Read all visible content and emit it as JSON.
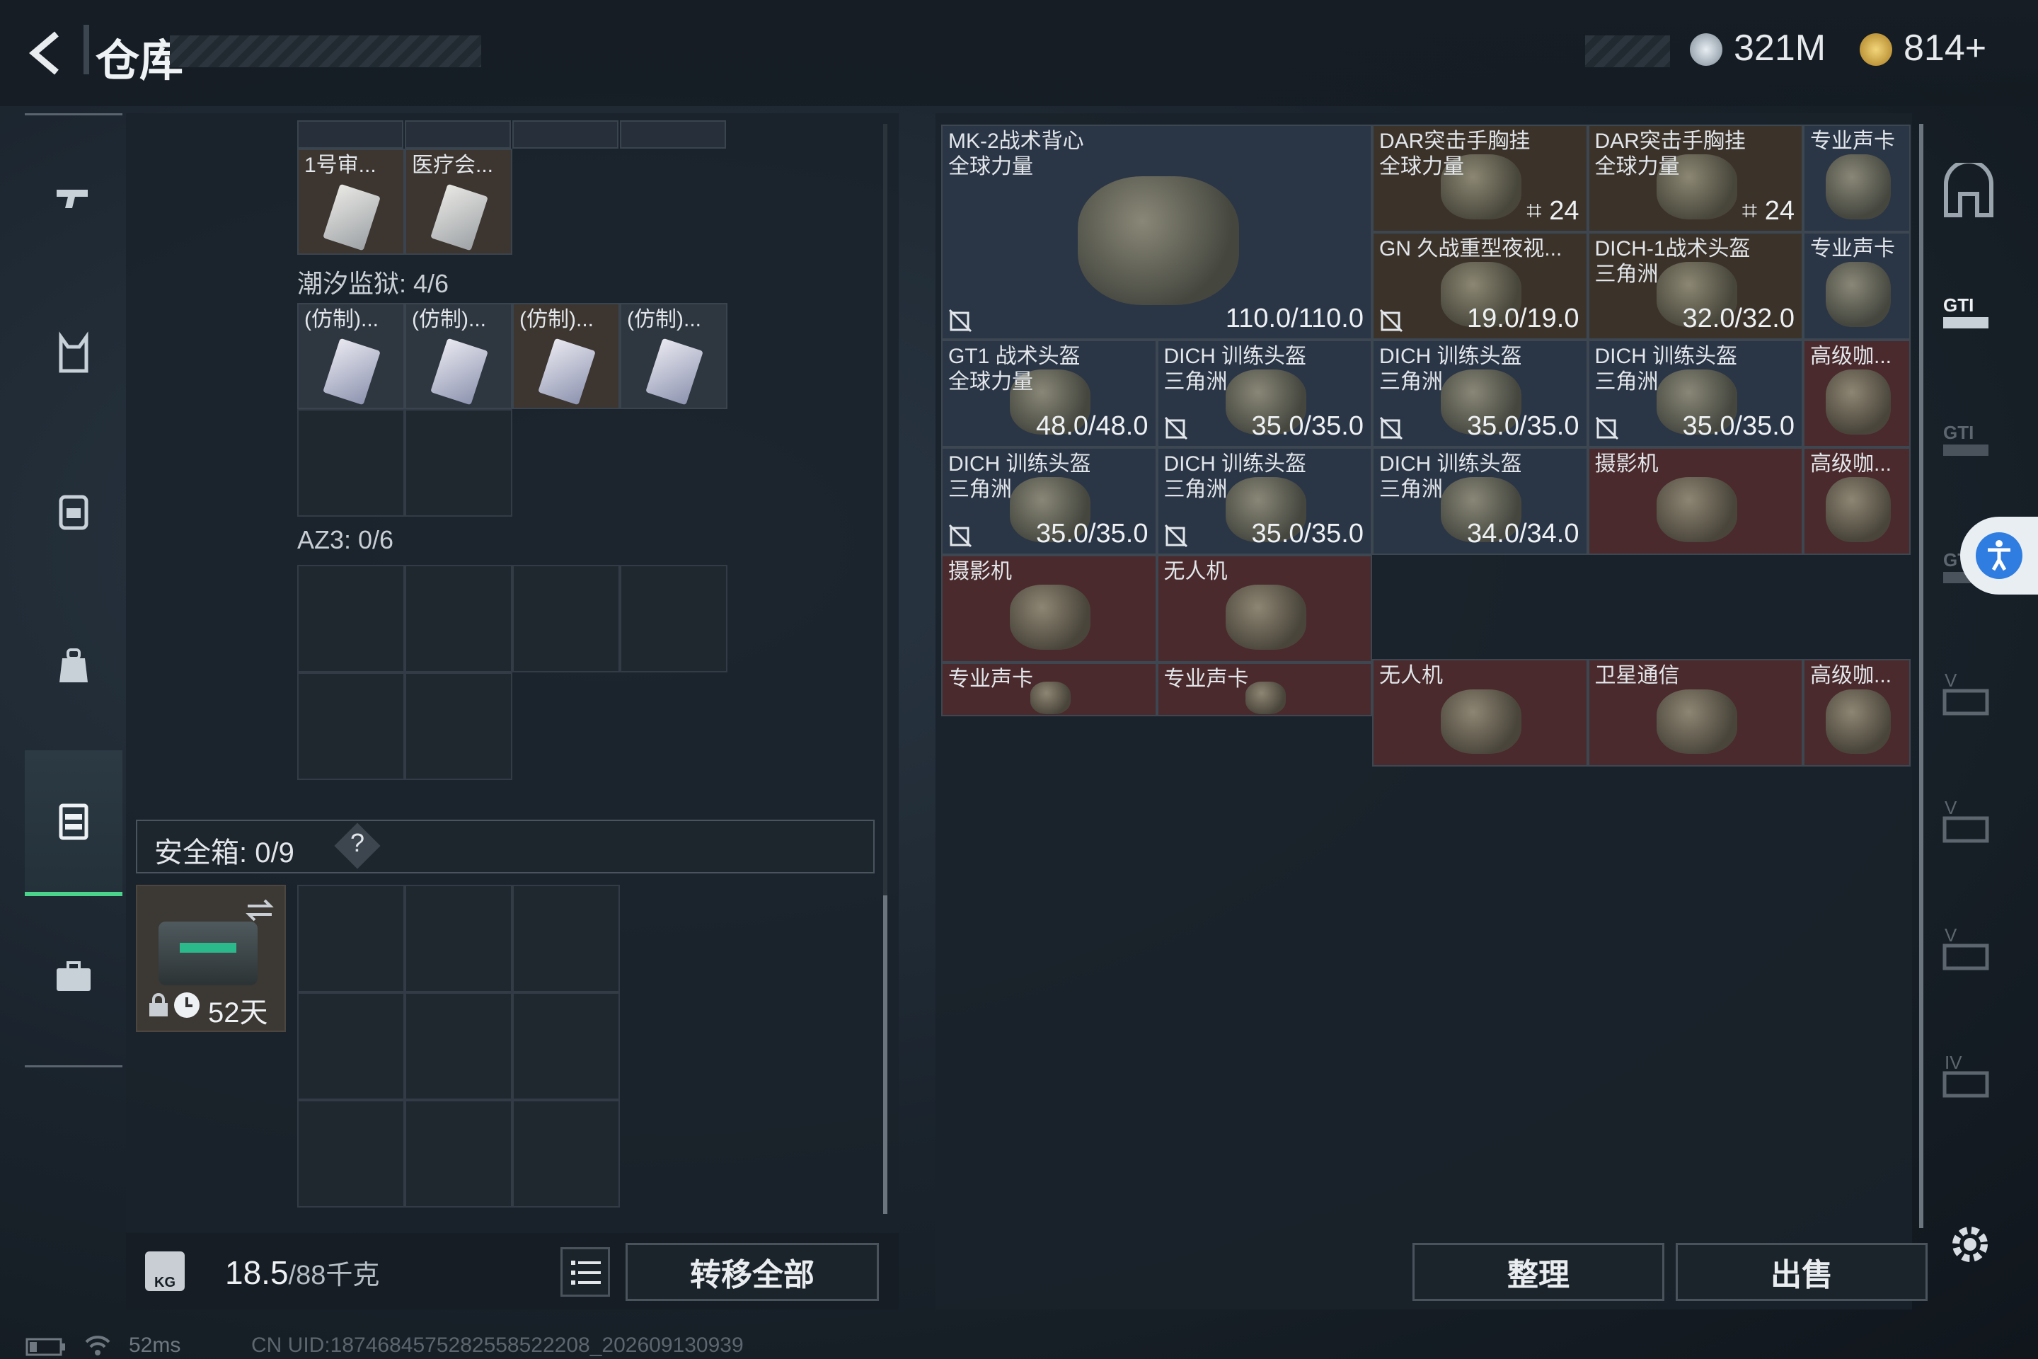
{
  "header": {
    "title": "仓库",
    "currency1": "321M",
    "currency2": "814+",
    "back_icon": "back-arrow-icon"
  },
  "sidebar": {
    "items": [
      {
        "icon": "pistol-icon"
      },
      {
        "icon": "vest-icon"
      },
      {
        "icon": "backpack-icon"
      },
      {
        "icon": "pouch-icon"
      },
      {
        "icon": "case-icon",
        "active": true
      },
      {
        "icon": "briefcase-icon"
      }
    ]
  },
  "left_panel": {
    "top_items": [
      {
        "name": "1号审..."
      },
      {
        "name": "医疗会..."
      }
    ],
    "section1": {
      "label": "潮汐监狱: 4/6",
      "items": [
        "(仿制)...",
        "(仿制)...",
        "(仿制)...",
        "(仿制)..."
      ]
    },
    "section2": {
      "label": "AZ3: 0/6"
    },
    "safebox": {
      "label": "安全箱: 0/9",
      "help": "?",
      "timer": "52天"
    },
    "weight": {
      "value": "18.5",
      "max": "/88千克",
      "kg_icon": "KG"
    },
    "transfer_all": "转移全部"
  },
  "grid": [
    {
      "name": "MK-2战术背心",
      "sub": "全球力量",
      "stat": "110.0/110.0",
      "color": "blue",
      "no_icon": true
    },
    {
      "name": "DAR突击手胸挂",
      "sub": "全球力量",
      "stat": "24",
      "color": "brown",
      "slot_icon": true
    },
    {
      "name": "DAR突击手胸挂",
      "sub": "全球力量",
      "stat": "24",
      "color": "brown",
      "slot_icon": true
    },
    {
      "name": "专业声卡",
      "sub": "",
      "stat": "",
      "color": "blue"
    },
    {
      "name": "GN 久战重型夜视...",
      "sub": "",
      "stat": "19.0/19.0",
      "color": "brown",
      "no_icon": true
    },
    {
      "name": "DICH-1战术头盔",
      "sub": "三角洲",
      "stat": "32.0/32.0",
      "color": "brown"
    },
    {
      "name": "专业声卡",
      "sub": "",
      "stat": "",
      "color": "blue"
    },
    {
      "name": "GT1 战术头盔",
      "sub": "全球力量",
      "stat": "48.0/48.0",
      "color": "blue"
    },
    {
      "name": "DICH 训练头盔",
      "sub": "三角洲",
      "stat": "35.0/35.0",
      "color": "blue",
      "no_icon": true
    },
    {
      "name": "DICH 训练头盔",
      "sub": "三角洲",
      "stat": "35.0/35.0",
      "color": "blue",
      "no_icon": true
    },
    {
      "name": "DICH 训练头盔",
      "sub": "三角洲",
      "stat": "35.0/35.0",
      "color": "blue",
      "no_icon": true
    },
    {
      "name": "高级咖...",
      "sub": "",
      "stat": "",
      "color": "red"
    },
    {
      "name": "DICH 训练头盔",
      "sub": "三角洲",
      "stat": "35.0/35.0",
      "color": "blue",
      "no_icon": true
    },
    {
      "name": "DICH 训练头盔",
      "sub": "三角洲",
      "stat": "35.0/35.0",
      "color": "blue",
      "no_icon": true
    },
    {
      "name": "DICH 训练头盔",
      "sub": "三角洲",
      "stat": "34.0/34.0",
      "color": "blue"
    },
    {
      "name": "摄影机",
      "sub": "",
      "stat": "",
      "color": "red"
    },
    {
      "name": "高级咖...",
      "sub": "",
      "stat": "",
      "color": "red"
    },
    {
      "name": "摄影机",
      "sub": "",
      "stat": "",
      "color": "red"
    },
    {
      "name": "无人机",
      "sub": "",
      "stat": "",
      "color": "red"
    },
    {
      "name": "无人机",
      "sub": "",
      "stat": "",
      "color": "red"
    },
    {
      "name": "卫星通信",
      "sub": "",
      "stat": "",
      "color": "red"
    },
    {
      "name": "高级咖...",
      "sub": "",
      "stat": "",
      "color": "red"
    },
    {
      "name": "专业声卡",
      "sub": "",
      "stat": "",
      "color": "red"
    },
    {
      "name": "专业声卡",
      "sub": "",
      "stat": "",
      "color": "red"
    }
  ],
  "buttons": {
    "sort": "整理",
    "sell": "出售"
  },
  "footer": {
    "ping": "52ms",
    "uid": "CN UID:1874684575282558522208_202609130939"
  },
  "right_rail": [
    "vault-icon",
    "gti-icon",
    "gti-icon",
    "gti-icon",
    "video-icon",
    "video-icon",
    "video-icon",
    "video-plus-icon"
  ],
  "colors": {
    "accent": "#4bd38c",
    "blue": "#2a3546",
    "brown": "#3b322a",
    "red": "#4a2a2c"
  }
}
